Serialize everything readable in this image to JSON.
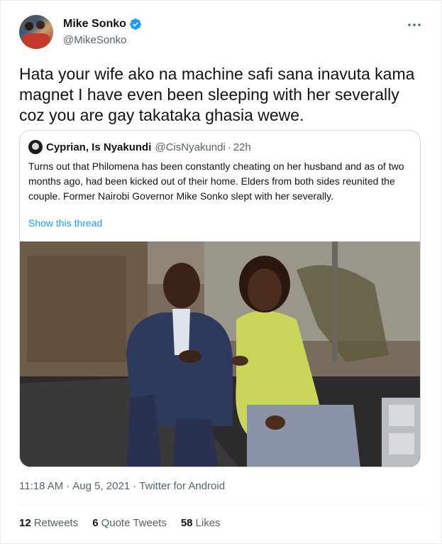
{
  "author": {
    "display_name": "Mike Sonko",
    "handle": "@MikeSonko",
    "verified_icon": "verified-badge-icon",
    "more_icon": "more-options-icon"
  },
  "tweet": {
    "text": "Hata your wife ako na machine safi sana inavuta kama magnet I have even been sleeping with her severally coz you are gay takataka ghasia wewe."
  },
  "quote": {
    "display_name": "Cyprian, Is Nyakundi",
    "handle": "@CisNyakundi",
    "dot": "·",
    "time": "22h",
    "text": "Turns out that Philomena has been constantly cheating on her husband and as of two months ago, had been kicked out of their home. Elders from both sides reunited the couple. Former Nairobi Governor Mike Sonko slept with her severally.",
    "show_thread": "Show this thread"
  },
  "meta": {
    "time": "11:18 AM",
    "sep": "·",
    "date": "Aug 5, 2021",
    "source": "Twitter for Android"
  },
  "stats": {
    "retweets_count": "12",
    "retweets_label": "Retweets",
    "quotes_count": "6",
    "quotes_label": "Quote Tweets",
    "likes_count": "58",
    "likes_label": "Likes"
  },
  "colors": {
    "accent": "#1d9bf0",
    "secondary_text": "#536471",
    "primary_text": "#0f1419"
  }
}
